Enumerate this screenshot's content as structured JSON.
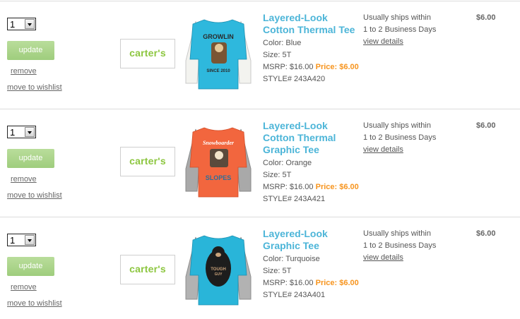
{
  "colors": {
    "brand_green": "#8cc63f",
    "title_blue": "#4cb5d8",
    "price_orange": "#f7941d",
    "update_green": "#a6d286"
  },
  "items": [
    {
      "quantity": "1",
      "update_label": "update",
      "remove_label": "remove",
      "wishlist_label": "move to wishlist",
      "brand": "carter's",
      "title": "Layered-Look Cotton Thermal Tee",
      "color": "Color: Blue",
      "size": "Size: 5T",
      "msrp": "MSRP: $16.00",
      "price": "Price: $6.00",
      "style": "STYLE# 243A420",
      "ship_line1": "Usually ships within",
      "ship_line2": "1 to 2 Business Days",
      "view_details": "view details",
      "total": "$6.00",
      "shirt_body": "#2eb8dd",
      "shirt_sleeve": "#f3f3ef",
      "graphic_text": "GROWLIN",
      "graphic_text2": "SINCE 2010",
      "graphic_color": "#2a2a2a"
    },
    {
      "quantity": "1",
      "update_label": "update",
      "remove_label": "remove",
      "wishlist_label": "move to wishlist",
      "brand": "carter's",
      "title": "Layered-Look Cotton Thermal Graphic Tee",
      "color": "Color: Orange",
      "size": "Size: 5T",
      "msrp": "MSRP: $16.00",
      "price": "Price: $6.00",
      "style": "STYLE# 243A421",
      "ship_line1": "Usually ships within",
      "ship_line2": "1 to 2 Business Days",
      "view_details": "view details",
      "total": "$6.00",
      "shirt_body": "#f2663e",
      "shirt_sleeve": "#a9a9a9",
      "graphic_text": "Snowboarder",
      "graphic_text2": "SLOPES",
      "graphic_color": "#2d6f9a"
    },
    {
      "quantity": "1",
      "update_label": "update",
      "remove_label": "remove",
      "wishlist_label": "move to wishlist",
      "brand": "carter's",
      "title": "Layered-Look Graphic Tee",
      "color": "Color: Turquoise",
      "size": "Size: 5T",
      "msrp": "MSRP: $16.00",
      "price": "Price: $6.00",
      "style": "STYLE# 243A401",
      "ship_line1": "Usually ships within",
      "ship_line2": "1 to 2 Business Days",
      "view_details": "view details",
      "total": "$6.00",
      "shirt_body": "#29b5d9",
      "shirt_sleeve": "#b2b2b2",
      "graphic_text": "TOUGH",
      "graphic_text2": "GUY",
      "graphic_color": "#1d1d1d"
    }
  ]
}
